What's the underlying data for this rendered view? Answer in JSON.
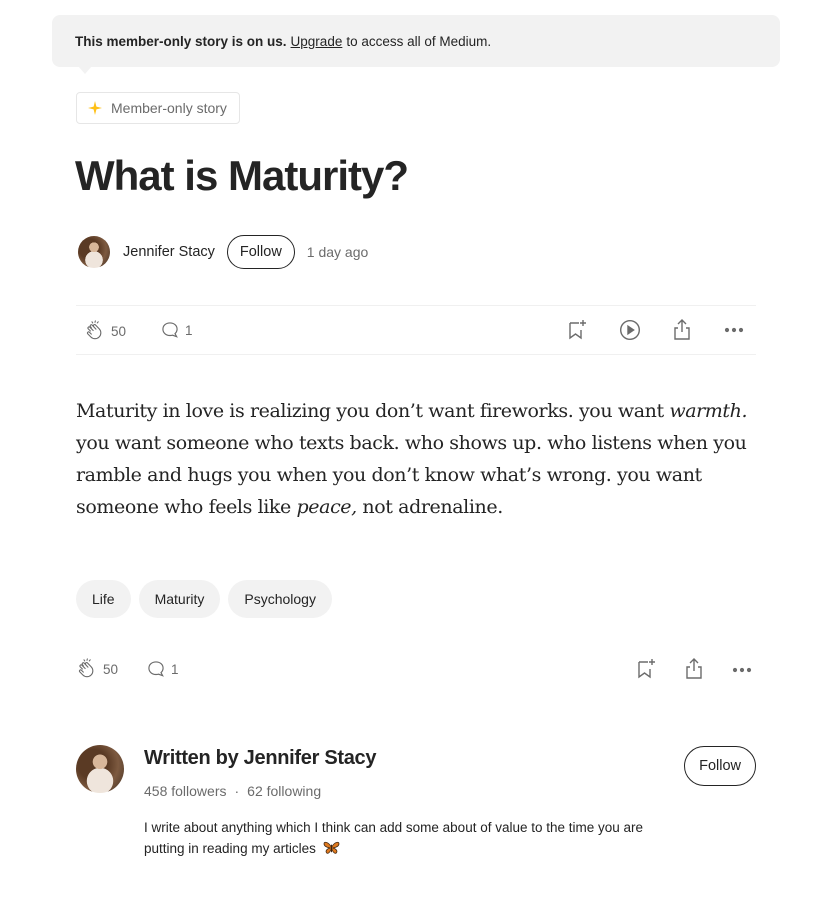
{
  "banner": {
    "strong": "This member-only story is on us.",
    "link": "Upgrade",
    "rest": "to access all of Medium."
  },
  "member_pill": {
    "label": "Member-only story",
    "icon": "sparkle-icon",
    "icon_color": "#ffc017"
  },
  "article": {
    "title": "What is Maturity?",
    "author": "Jennifer Stacy",
    "follow_label": "Follow",
    "time_ago": "1 day ago",
    "claps": "50",
    "responses": "1",
    "body": {
      "p1": "Maturity in love is realizing you don’t want fireworks. you want ",
      "em1": "warmth.",
      "p2": " you want someone who texts back. who shows up. who listens when you ramble and hugs you when you don’t know what’s wrong. you want someone who feels like ",
      "em2": "peace,",
      "p3": " not adrenaline."
    },
    "tags": [
      "Life",
      "Maturity",
      "Psychology"
    ]
  },
  "author_card": {
    "heading": "Written by Jennifer Stacy",
    "followers": "458 followers",
    "separator": "·",
    "following": "62 following",
    "bio": "I write about anything which I think can add some about of value to the time you are putting in reading my articles",
    "bio_emoji": "butterfly-icon",
    "follow_label": "Follow"
  },
  "colors": {
    "text": "#242424",
    "muted": "#6b6b6b",
    "banner_bg": "#f2f2f2",
    "tag_bg": "#f2f2f2"
  }
}
